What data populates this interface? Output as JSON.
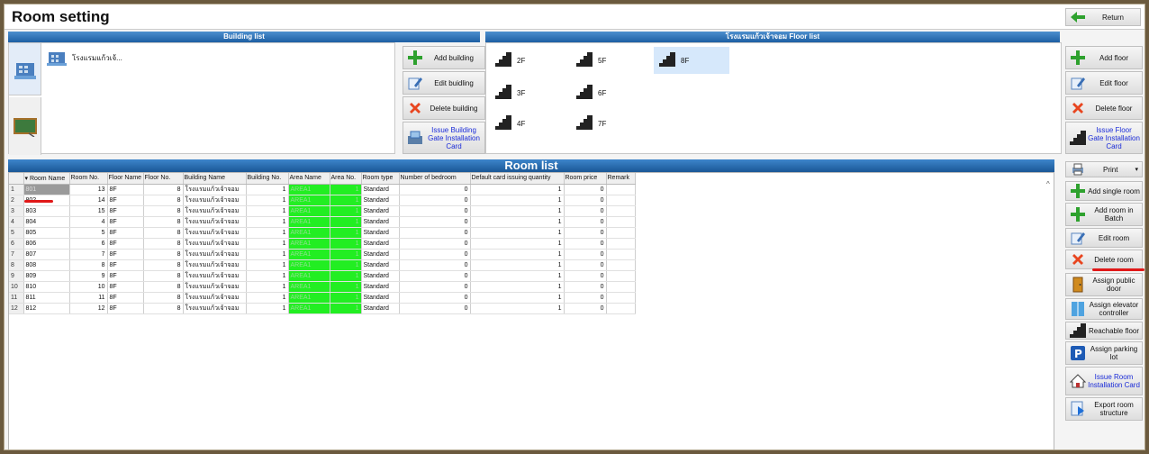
{
  "window": {
    "title": "Room setting",
    "return_label": "Return"
  },
  "building_panel": {
    "header": "Building list",
    "item_label": "โรงแรมแก้วเจ้...",
    "buttons": [
      "Add building",
      "Edit buidling",
      "Delete building",
      "Issue Building Gate Installation Card"
    ]
  },
  "floor_panel": {
    "header": "โรงแรมแก้วเจ้าจอม Floor list",
    "floors": [
      "2F",
      "5F",
      "8F",
      "3F",
      "6F",
      "4F",
      "7F"
    ],
    "selected_floor": "8F",
    "buttons": [
      "Add floor",
      "Edit floor",
      "Delete floor",
      "Issue Floor Gate Installation Card"
    ]
  },
  "room_list": {
    "title": "Room list",
    "columns": [
      "Room Name",
      "Room No.",
      "Floor Name",
      "Floor No.",
      "Building Name",
      "Building No.",
      "Area Name",
      "Area No.",
      "Room type",
      "Number of bedroom",
      "Default card issuing quantity",
      "Room price",
      "Remark"
    ],
    "rows": [
      {
        "n": "1",
        "room": "801",
        "no": "13",
        "floor": "8F",
        "floorno": "8",
        "bname": "โรงแรมแก้วเจ้าจอม",
        "bno": "1",
        "area": "AREA1",
        "areano": "1",
        "type": "Standard",
        "bed": "0",
        "cards": "1",
        "price": "0"
      },
      {
        "n": "2",
        "room": "802",
        "no": "14",
        "floor": "8F",
        "floorno": "8",
        "bname": "โรงแรมแก้วเจ้าจอม",
        "bno": "1",
        "area": "AREA1",
        "areano": "1",
        "type": "Standard",
        "bed": "0",
        "cards": "1",
        "price": "0"
      },
      {
        "n": "3",
        "room": "803",
        "no": "15",
        "floor": "8F",
        "floorno": "8",
        "bname": "โรงแรมแก้วเจ้าจอม",
        "bno": "1",
        "area": "AREA1",
        "areano": "1",
        "type": "Standard",
        "bed": "0",
        "cards": "1",
        "price": "0"
      },
      {
        "n": "4",
        "room": "804",
        "no": "4",
        "floor": "8F",
        "floorno": "8",
        "bname": "โรงแรมแก้วเจ้าจอม",
        "bno": "1",
        "area": "AREA1",
        "areano": "1",
        "type": "Standard",
        "bed": "0",
        "cards": "1",
        "price": "0"
      },
      {
        "n": "5",
        "room": "805",
        "no": "5",
        "floor": "8F",
        "floorno": "8",
        "bname": "โรงแรมแก้วเจ้าจอม",
        "bno": "1",
        "area": "AREA1",
        "areano": "1",
        "type": "Standard",
        "bed": "0",
        "cards": "1",
        "price": "0"
      },
      {
        "n": "6",
        "room": "806",
        "no": "6",
        "floor": "8F",
        "floorno": "8",
        "bname": "โรงแรมแก้วเจ้าจอม",
        "bno": "1",
        "area": "AREA1",
        "areano": "1",
        "type": "Standard",
        "bed": "0",
        "cards": "1",
        "price": "0"
      },
      {
        "n": "7",
        "room": "807",
        "no": "7",
        "floor": "8F",
        "floorno": "8",
        "bname": "โรงแรมแก้วเจ้าจอม",
        "bno": "1",
        "area": "AREA1",
        "areano": "1",
        "type": "Standard",
        "bed": "0",
        "cards": "1",
        "price": "0"
      },
      {
        "n": "8",
        "room": "808",
        "no": "8",
        "floor": "8F",
        "floorno": "8",
        "bname": "โรงแรมแก้วเจ้าจอม",
        "bno": "1",
        "area": "AREA1",
        "areano": "1",
        "type": "Standard",
        "bed": "0",
        "cards": "1",
        "price": "0"
      },
      {
        "n": "9",
        "room": "809",
        "no": "9",
        "floor": "8F",
        "floorno": "8",
        "bname": "โรงแรมแก้วเจ้าจอม",
        "bno": "1",
        "area": "AREA1",
        "areano": "1",
        "type": "Standard",
        "bed": "0",
        "cards": "1",
        "price": "0"
      },
      {
        "n": "10",
        "room": "810",
        "no": "10",
        "floor": "8F",
        "floorno": "8",
        "bname": "โรงแรมแก้วเจ้าจอม",
        "bno": "1",
        "area": "AREA1",
        "areano": "1",
        "type": "Standard",
        "bed": "0",
        "cards": "1",
        "price": "0"
      },
      {
        "n": "11",
        "room": "811",
        "no": "11",
        "floor": "8F",
        "floorno": "8",
        "bname": "โรงแรมแก้วเจ้าจอม",
        "bno": "1",
        "area": "AREA1",
        "areano": "1",
        "type": "Standard",
        "bed": "0",
        "cards": "1",
        "price": "0"
      },
      {
        "n": "12",
        "room": "812",
        "no": "12",
        "floor": "8F",
        "floorno": "8",
        "bname": "โรงแรมแก้วเจ้าจอม",
        "bno": "1",
        "area": "AREA1",
        "areano": "1",
        "type": "Standard",
        "bed": "0",
        "cards": "1",
        "price": "0"
      }
    ]
  },
  "room_actions": {
    "print_label": "Print",
    "buttons": [
      "Add single room",
      "Add room in Batch",
      "Edit room",
      "Delete room",
      "Assign public door",
      "Assign elevator controller",
      "Reachable floor",
      "Assign parking lot",
      "Issue Room Installation Card",
      "Export room structure"
    ]
  },
  "colors": {
    "header_blue": "#1d5fa3",
    "area_green": "#22ee22",
    "highlight_red": "#e01818",
    "link_blue": "#1a2bd8"
  }
}
